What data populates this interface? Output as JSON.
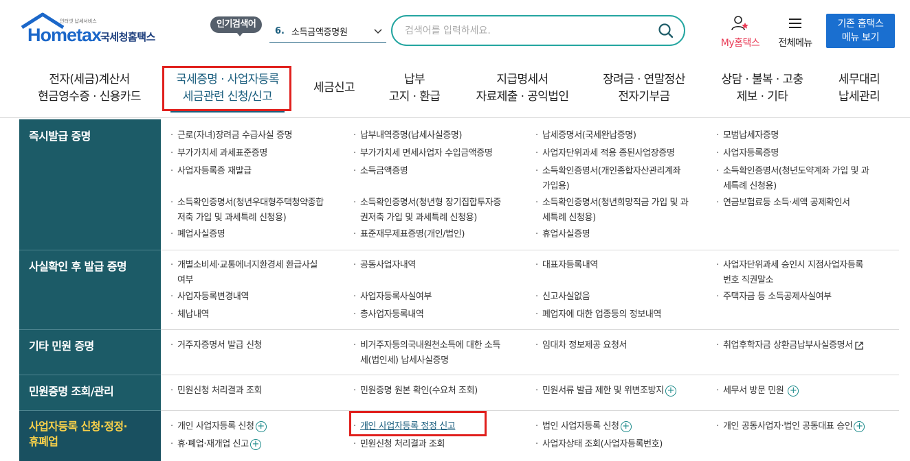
{
  "header": {
    "logo": {
      "brand": "Hometax",
      "brand_sub": "인터넷 납세서비스",
      "brand_kr": "국세청홈택스"
    },
    "popular": {
      "badge": "인기검색어",
      "rank": "6.",
      "keyword": "소득금액증명원"
    },
    "search": {
      "placeholder": "검색어를 입력하세요."
    },
    "my_hometax": "My홈택스",
    "all_menu": "전체메뉴",
    "old_home": {
      "line1": "기존 홈택스",
      "line2": "메뉴 보기"
    }
  },
  "gnb": [
    {
      "line1": "전자(세금)계산서",
      "line2": "현금영수증 · 신용카드"
    },
    {
      "line1": "국세증명 · 사업자등록",
      "line2": "세금관련 신청/신고"
    },
    {
      "line1": "세금신고",
      "line2": ""
    },
    {
      "line1": "납부",
      "line2": "고지 · 환급"
    },
    {
      "line1": "지급명세서",
      "line2": "자료제출 · 공익법인"
    },
    {
      "line1": "장려금 · 연말정산",
      "line2": "전자기부금"
    },
    {
      "line1": "상담 · 불복 · 고충",
      "line2": "제보 · 기타"
    },
    {
      "line1": "세무대리",
      "line2": "납세관리"
    }
  ],
  "categories": [
    {
      "label": "즉시발급 증명"
    },
    {
      "label": "사실확인 후 발급 증명"
    },
    {
      "label": "기타 민원 증명"
    },
    {
      "label": "민원증명 조회/관리"
    },
    {
      "label_line1": "사업자등록 신청·정정·",
      "label_line2": "휴폐업"
    }
  ],
  "items": {
    "c1": [
      "근로(자녀)장려금 수급사실 증명",
      "납부내역증명(납세사실증명)",
      "납세증명서(국세완납증명)",
      "모범납세자증명",
      "부가가치세 과세표준증명",
      "부가가치세 면세사업자 수입금액증명",
      "사업자단위과세 적용 종된사업장증명",
      "사업자등록증명",
      "사업자등록증 재발급",
      "소득금액증명",
      {
        "l1": "소득확인증명서(개인종합자산관리계좌",
        "l2": "가입용)"
      },
      {
        "l1": "소득확인증명서(청년도약계좌 가입 및 과",
        "l2": "세특례 신청용)"
      },
      {
        "l1": "소득확인증명서(청년우대형주택청약종합",
        "l2": "저축 가입 및 과세특례 신청용)"
      },
      {
        "l1": "소득확인증명서(청년형 장기집합투자증",
        "l2": "권저축 가입 및 과세특례 신청용)"
      },
      {
        "l1": "소득확인증명서(청년희망적금 가입 및 과",
        "l2": "세특례 신청용)"
      },
      "연금보험료등 소득·세액 공제확인서",
      "폐업사실증명",
      "표준재무제표증명(개인/법인)",
      "휴업사실증명"
    ],
    "c2": [
      {
        "l1": "개별소비세·교통에너지환경세 환급사실",
        "l2": "여부"
      },
      "공동사업자내역",
      "대표자등록내역",
      {
        "l1": "사업자단위과세 승인시 지점사업자등록",
        "l2": "번호 직권말소"
      },
      "사업자등록변경내역",
      "사업자등록사실여부",
      "신고사실없음",
      "주택자금 등 소득공제사실여부",
      "체납내역",
      "총사업자등록내역",
      "폐업자에 대한 업종등의 정보내역"
    ],
    "c3": [
      "거주자증명서 발급 신청",
      {
        "l1": "비거주자등의국내원천소득에 대한 소득",
        "l2": "세(법인세) 납세사실증명"
      },
      "임대차 정보제공 요청서",
      "취업후학자금 상환금납부사실증명서"
    ],
    "c4": [
      "민원신청 처리결과 조회",
      "민원증명 원본 확인(수요처 조회)",
      "민원서류 발급 제한 및 위변조방지",
      "세무서 방문 민원"
    ],
    "c5": [
      "개인 사업자등록 신청",
      "개인 사업자등록 정정 신고",
      "법인 사업자등록 신청",
      "개인 공동사업자·법인 공동대표 승인",
      "휴·폐업·재개업 신고",
      "민원신청 처리결과 조회",
      "사업자상태 조회(사업자등록번호)"
    ]
  },
  "colors": {
    "teal": "#1c5b67",
    "brand_blue": "#1b67c9",
    "accent_red": "#e0201d",
    "highlight_yellow": "#f7d04a"
  }
}
